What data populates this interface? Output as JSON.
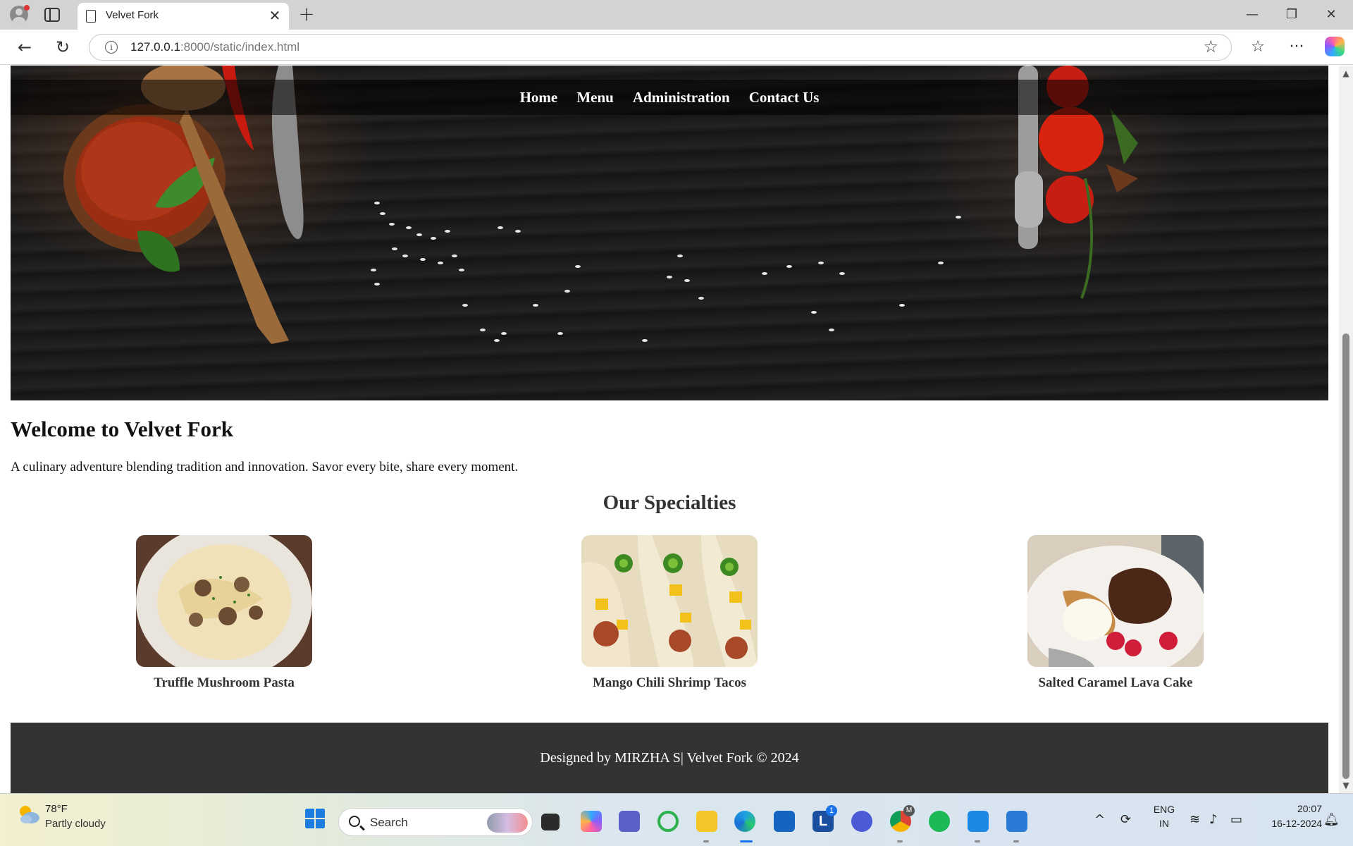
{
  "browser": {
    "tab_title": "Velvet Fork",
    "url_host": "127.0.0.1",
    "url_path": ":8000/static/index.html"
  },
  "nav": {
    "items": [
      {
        "label": "Home"
      },
      {
        "label": "Menu"
      },
      {
        "label": "Administration"
      },
      {
        "label": "Contact Us"
      }
    ]
  },
  "welcome": {
    "title": "Welcome to Velvet Fork",
    "text": "A culinary adventure blending tradition and innovation. Savor every bite, share every moment."
  },
  "specialties": {
    "title": "Our Specialties",
    "dishes": [
      {
        "name": "Truffle Mushroom Pasta"
      },
      {
        "name": "Mango Chili Shrimp Tacos"
      },
      {
        "name": "Salted Caramel Lava Cake"
      }
    ]
  },
  "footer": {
    "text": "Designed by MIRZHA S| Velvet Fork © 2024"
  },
  "taskbar": {
    "weather_temp": "78°F",
    "weather_desc": "Partly cloudy",
    "search_label": "Search",
    "lang_top": "ENG",
    "lang_bottom": "IN",
    "time": "20:07",
    "date": "16-12-2024",
    "teams_badge": "1",
    "chrome_badge": "M"
  },
  "icons": {
    "back": "back-arrow-icon",
    "reload": "reload-icon",
    "info": "info-icon",
    "favorite": "star-icon",
    "windows": "windows-start-icon"
  }
}
